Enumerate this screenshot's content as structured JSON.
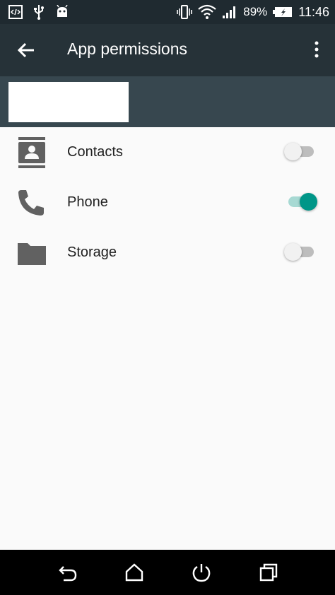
{
  "status_bar": {
    "icons_left": [
      "code-icon",
      "usb-icon",
      "android-icon"
    ],
    "icons_right": [
      "vibrate-icon",
      "wifi-icon",
      "signal-icon",
      "battery-charging-icon"
    ],
    "battery_percent": "89%",
    "time": "11:46"
  },
  "app_bar": {
    "back_icon": "arrow-back-icon",
    "title": "App permissions",
    "menu_icon": "more-vert-icon"
  },
  "permissions": [
    {
      "label": "Contacts",
      "icon": "contacts-icon",
      "enabled": false
    },
    {
      "label": "Phone",
      "icon": "phone-icon",
      "enabled": true
    },
    {
      "label": "Storage",
      "icon": "folder-icon",
      "enabled": false
    }
  ],
  "nav_bar": {
    "buttons": [
      "back-nav-icon",
      "home-nav-icon",
      "power-nav-icon",
      "recents-nav-icon"
    ]
  },
  "colors": {
    "status_bar": "#1f2a30",
    "app_bar": "#263238",
    "header": "#37474f",
    "accent": "#009688",
    "background": "#fafafa"
  }
}
